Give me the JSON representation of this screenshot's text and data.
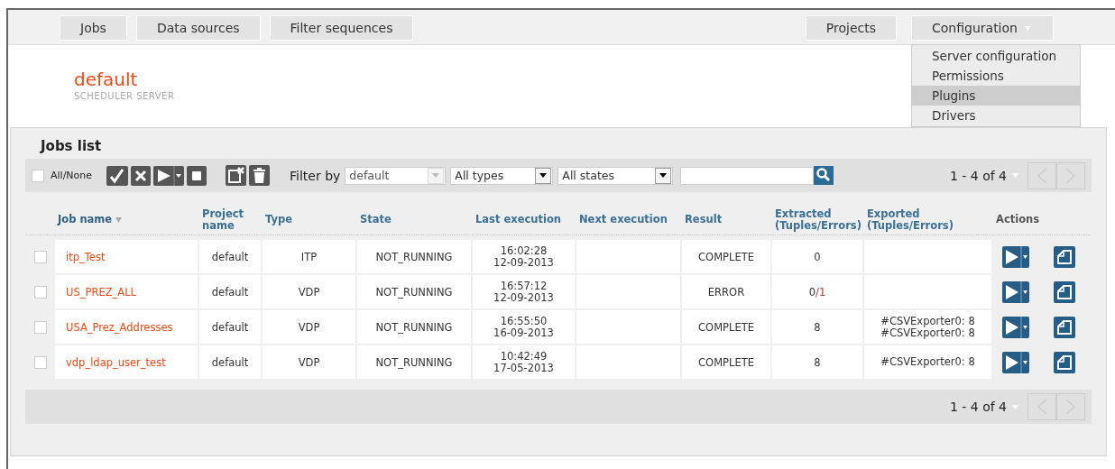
{
  "nav": {
    "left": [
      {
        "label": "Jobs"
      },
      {
        "label": "Data sources"
      },
      {
        "label": "Filter sequences"
      }
    ],
    "right": [
      {
        "label": "Projects",
        "kind": "tab"
      },
      {
        "label": "Configuration",
        "kind": "menu"
      }
    ]
  },
  "config_menu": [
    {
      "label": "Server configuration",
      "selected": false
    },
    {
      "label": "Permissions",
      "selected": false
    },
    {
      "label": "Plugins",
      "selected": true
    },
    {
      "label": "Drivers",
      "selected": false
    }
  ],
  "header": {
    "title": "default",
    "subtitle": "SCHEDULER SERVER"
  },
  "jobs_list": {
    "title": "Jobs list",
    "toolbar": {
      "all_none": {
        "label": "All/None",
        "checked": false
      },
      "filter_label": "Filter by",
      "project_filter": "default",
      "type_filter": "All types",
      "state_filter": "All states",
      "pagination": "1 - 4 of 4"
    },
    "columns": [
      {
        "label": "Job name",
        "sorted": true
      },
      {
        "label": "Project name",
        "sorted": false
      },
      {
        "label": "Type",
        "sorted": false
      },
      {
        "label": "State",
        "sorted": false
      },
      {
        "label": "Last execution",
        "sorted": false
      },
      {
        "label": "Next execution",
        "sorted": false
      },
      {
        "label": "Result",
        "sorted": false
      },
      {
        "label": "Extracted (Tuples/Errors)",
        "sorted": false
      },
      {
        "label": "Exported (Tuples/Errors)",
        "sorted": false
      },
      {
        "label": "Actions",
        "sorted": false
      }
    ],
    "rows": [
      {
        "checked": false,
        "name": "itp_Test",
        "project": "default",
        "type": "ITP",
        "state": "NOT_RUNNING",
        "last_time": "16:02:28",
        "last_date": "12-09-2013",
        "result": "COMPLETE",
        "extracted": "0"
      },
      {
        "checked": false,
        "name": "US_PREZ_ALL",
        "project": "default",
        "type": "VDP",
        "state": "NOT_RUNNING",
        "last_time": "16:57:12",
        "last_date": "12-09-2013",
        "result": "ERROR",
        "extracted": "0",
        "errors": "/1"
      },
      {
        "checked": false,
        "name": "USA_Prez_Addresses",
        "project": "default",
        "type": "VDP",
        "state": "NOT_RUNNING",
        "last_time": "16:55:50",
        "last_date": "16-09-2013",
        "result": "COMPLETE",
        "extracted": "8",
        "exported": [
          "#CSVExporter0: 8",
          "#CSVExporter0: 8"
        ]
      },
      {
        "checked": false,
        "name": "vdp_ldap_user_test",
        "project": "default",
        "type": "VDP",
        "state": "NOT_RUNNING",
        "last_time": "10:42:49",
        "last_date": "17-05-2013",
        "result": "COMPLETE",
        "extracted": "8",
        "exported": [
          "#CSVExporter0: 8"
        ]
      }
    ],
    "footer_pagination": "1 - 4 of 4"
  }
}
